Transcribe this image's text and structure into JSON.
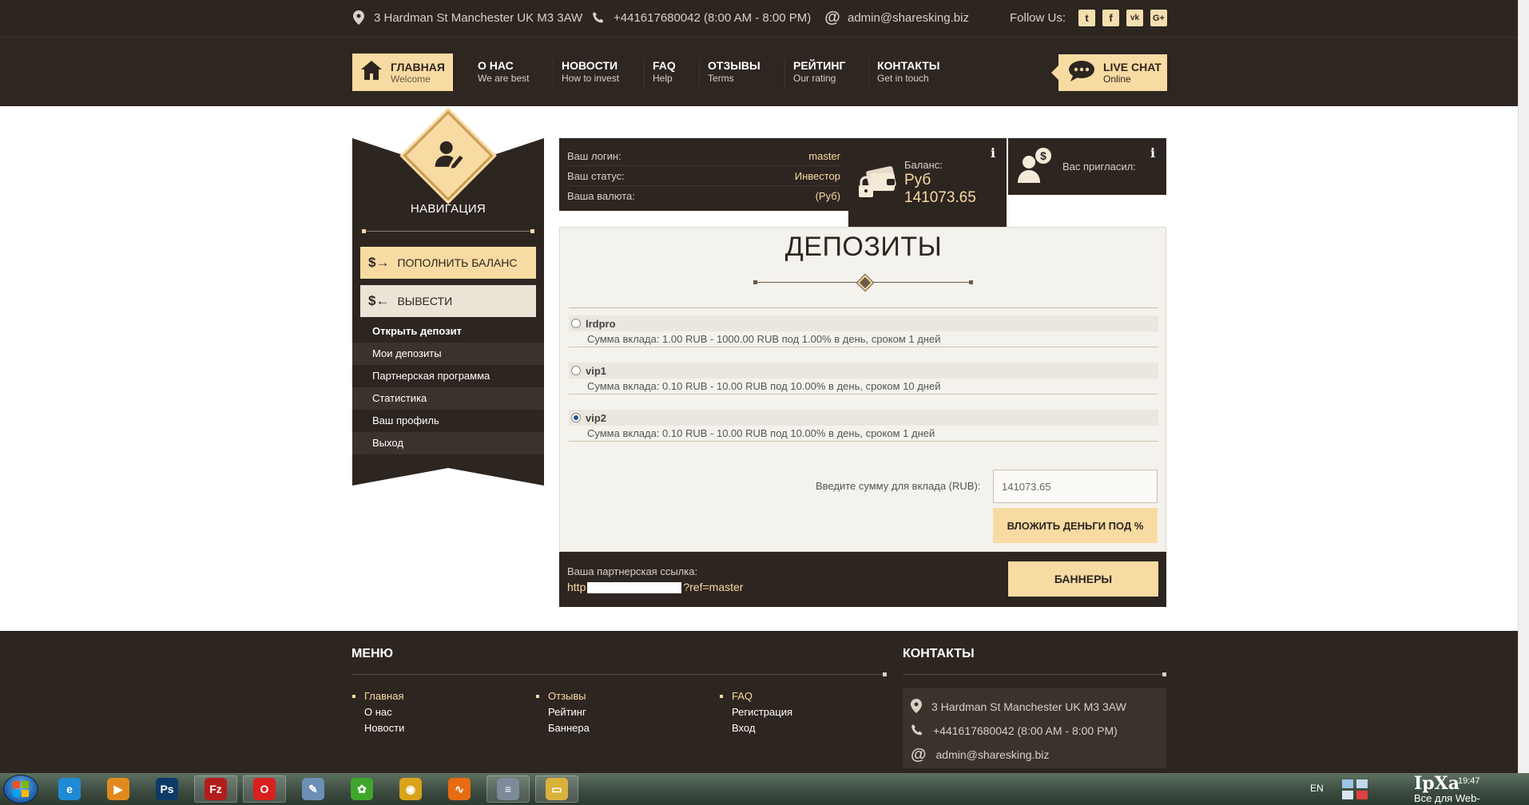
{
  "topbar": {
    "address": "3 Hardman St Manchester UK M3 3AW",
    "phone": "+441617680042 (8:00 AM - 8:00 PM)",
    "email": "admin@sharesking.biz",
    "follow_label": "Follow Us:",
    "social": [
      {
        "icon": "twitter-icon",
        "glyph": "t"
      },
      {
        "icon": "facebook-icon",
        "glyph": "f"
      },
      {
        "icon": "vk-icon",
        "glyph": "vk"
      },
      {
        "icon": "google-plus-icon",
        "glyph": "G+"
      }
    ]
  },
  "nav": {
    "home": {
      "title": "ГЛАВНАЯ",
      "subtitle": "Welcome"
    },
    "items": [
      {
        "title": "О НАС",
        "subtitle": "We are best"
      },
      {
        "title": "НОВОСТИ",
        "subtitle": "How to invest"
      },
      {
        "title": "FAQ",
        "subtitle": "Help"
      },
      {
        "title": "ОТЗЫВЫ",
        "subtitle": "Terms"
      },
      {
        "title": "РЕЙТИНГ",
        "subtitle": "Our rating"
      },
      {
        "title": "КОНТАКТЫ",
        "subtitle": "Get in touch"
      }
    ],
    "livechat": {
      "title": "LIVE CHAT",
      "subtitle": "Online"
    }
  },
  "sidebar": {
    "title": "НАВИГАЦИЯ",
    "deposit_button": "ПОПОЛНИТЬ БАЛАНС",
    "withdraw_button": "ВЫВЕСТИ",
    "menu": [
      "Открыть депозит",
      "Мои депозиты",
      "Партнерская программа",
      "Статистика",
      "Ваш профиль",
      "Выход"
    ]
  },
  "account": {
    "login_label": "Ваш логин:",
    "login_value": "master",
    "status_label": "Ваш статус:",
    "status_value": "Инвестор",
    "currency_label": "Ваша валюта:",
    "currency_value": "(Руб)"
  },
  "balance": {
    "label": "Баланс:",
    "currency": "Руб",
    "amount": "141073.65",
    "info": "i"
  },
  "referrer": {
    "label": "Вас пригласил:",
    "info": "i"
  },
  "deposits": {
    "title": "ДЕПОЗИТЫ",
    "plans": [
      {
        "name": "lrdpro",
        "selected": false,
        "description": "Сумма вклада: 1.00 RUB - 1000.00 RUB под 1.00% в день, сроком 1 дней"
      },
      {
        "name": "vip1",
        "selected": false,
        "description": "Сумма вклада: 0.10 RUB - 10.00 RUB под 10.00% в день, сроком 10 дней"
      },
      {
        "name": "vip2",
        "selected": true,
        "description": "Сумма вклада: 0.10 RUB - 10.00 RUB под 10.00% в день, сроком 1 дней"
      }
    ],
    "amount_label": "Введите сумму для вклада (RUB):",
    "amount_value": "141073.65",
    "invest_button": "ВЛОЖИТЬ ДЕНЬГИ ПОД %"
  },
  "referral": {
    "label": "Ваша партнерская ссылка:",
    "link_prefix": "http",
    "link_suffix": "?ref=master",
    "banners_button": "БАННЕРЫ"
  },
  "footer": {
    "menu_title": "МЕНЮ",
    "contacts_title": "КОНТАКТЫ",
    "col1": [
      "Главная",
      "О нас",
      "Новости"
    ],
    "col2": [
      "Отзывы",
      "Рейтинг",
      "Баннера"
    ],
    "col3": [
      "FAQ",
      "Регистрация",
      "Вход"
    ],
    "address": "3 Hardman St Manchester UK M3 3AW",
    "phone": "+441617680042 (8:00 AM - 8:00 PM)",
    "email": "admin@sharesking.biz"
  },
  "taskbar": {
    "language": "EN",
    "time": "19:47",
    "watermark": "IpXa",
    "watermark_sub": "Все для Web-мастера.NET",
    "apps": [
      {
        "icon": "internet-explorer-icon",
        "color": "#1f8ad6",
        "glyph": "e"
      },
      {
        "icon": "media-player-icon",
        "color": "#e08a1e",
        "glyph": "▶"
      },
      {
        "icon": "photoshop-icon",
        "color": "#0d3a67",
        "glyph": "Ps"
      },
      {
        "icon": "filezilla-icon",
        "color": "#b51c1c",
        "glyph": "Fz"
      },
      {
        "icon": "opera-icon",
        "color": "#d8201f",
        "glyph": "O"
      },
      {
        "icon": "paint-icon",
        "color": "#6c8fb5",
        "glyph": "✎"
      },
      {
        "icon": "icq-icon",
        "color": "#3fa62c",
        "glyph": "✿"
      },
      {
        "icon": "chrome-icon",
        "color": "#d9a31b",
        "glyph": "◉"
      },
      {
        "icon": "aimp-icon",
        "color": "#e66b12",
        "glyph": "∿"
      },
      {
        "icon": "text-editor-icon",
        "color": "#7d8a99",
        "glyph": "≡"
      },
      {
        "icon": "file-explorer-icon",
        "color": "#d9b23b",
        "glyph": "▭"
      }
    ]
  }
}
